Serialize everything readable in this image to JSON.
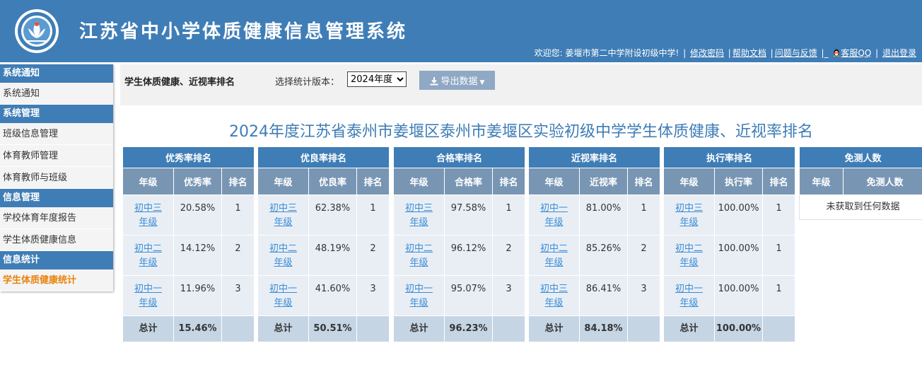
{
  "header": {
    "title": "江苏省中小学体质健康信息管理系统",
    "welcome": "欢迎您: 姜堰市第二中学附设初级中学!",
    "links": {
      "change_password": "修改密码",
      "help_docs": "帮助文档",
      "feedback": "问题与反馈",
      "qq": "客服QQ",
      "logout": "退出登录"
    }
  },
  "sidebar": {
    "groups": [
      {
        "title": "系统通知",
        "items": [
          "系统通知"
        ]
      },
      {
        "title": "系统管理",
        "items": [
          "班级信息管理",
          "体育教师管理",
          "体育教师与班级"
        ]
      },
      {
        "title": "信息管理",
        "items": [
          "学校体育年度报告",
          "学生体质健康信息"
        ]
      },
      {
        "title": "信息统计",
        "items": [
          "学生体质健康统计"
        ]
      }
    ],
    "active_item": "学生体质健康统计"
  },
  "toolbar": {
    "page_title": "学生体质健康、近视率排名",
    "version_label": "选择统计版本：",
    "version_selected": "2024年度",
    "export_label": "导出数据"
  },
  "report": {
    "title": "2024年度江苏省泰州市姜堰区泰州市姜堰区实验初级中学学生体质健康、近视率排名"
  },
  "tables": [
    {
      "title": "优秀率排名",
      "columns": [
        "年级",
        "优秀率",
        "排名"
      ],
      "rows": [
        {
          "grade": "初中三年级",
          "value": "20.58%",
          "rank": "1"
        },
        {
          "grade": "初中二年级",
          "value": "14.12%",
          "rank": "2"
        },
        {
          "grade": "初中一年级",
          "value": "11.96%",
          "rank": "3"
        }
      ],
      "total_label": "总计",
      "total_value": "15.46%"
    },
    {
      "title": "优良率排名",
      "columns": [
        "年级",
        "优良率",
        "排名"
      ],
      "rows": [
        {
          "grade": "初中三年级",
          "value": "62.38%",
          "rank": "1"
        },
        {
          "grade": "初中二年级",
          "value": "48.19%",
          "rank": "2"
        },
        {
          "grade": "初中一年级",
          "value": "41.60%",
          "rank": "3"
        }
      ],
      "total_label": "总计",
      "total_value": "50.51%"
    },
    {
      "title": "合格率排名",
      "columns": [
        "年级",
        "合格率",
        "排名"
      ],
      "rows": [
        {
          "grade": "初中三年级",
          "value": "97.58%",
          "rank": "1"
        },
        {
          "grade": "初中二年级",
          "value": "96.12%",
          "rank": "2"
        },
        {
          "grade": "初中一年级",
          "value": "95.07%",
          "rank": "3"
        }
      ],
      "total_label": "总计",
      "total_value": "96.23%"
    },
    {
      "title": "近视率排名",
      "columns": [
        "年级",
        "近视率",
        "排名"
      ],
      "rows": [
        {
          "grade": "初中一年级",
          "value": "81.00%",
          "rank": "1"
        },
        {
          "grade": "初中二年级",
          "value": "85.26%",
          "rank": "2"
        },
        {
          "grade": "初中三年级",
          "value": "86.41%",
          "rank": "3"
        }
      ],
      "total_label": "总计",
      "total_value": "84.18%"
    },
    {
      "title": "执行率排名",
      "columns": [
        "年级",
        "执行率",
        "排名"
      ],
      "rows": [
        {
          "grade": "初中三年级",
          "value": "100.00%",
          "rank": "1"
        },
        {
          "grade": "初中二年级",
          "value": "100.00%",
          "rank": "1"
        },
        {
          "grade": "初中一年级",
          "value": "100.00%",
          "rank": "1"
        }
      ],
      "total_label": "总计",
      "total_value": "100.00%"
    }
  ],
  "exempt_table": {
    "title": "免测人数",
    "columns": [
      "年级",
      "免测人数"
    ],
    "empty_text": "未获取到任何数据"
  },
  "colors": {
    "brand": "#3f7db6",
    "column_header": "#7896b4",
    "cell": "#e9eef5",
    "total_row": "#c5d5e4",
    "link": "#3a8ed6",
    "active_menu": "#e8830c"
  }
}
